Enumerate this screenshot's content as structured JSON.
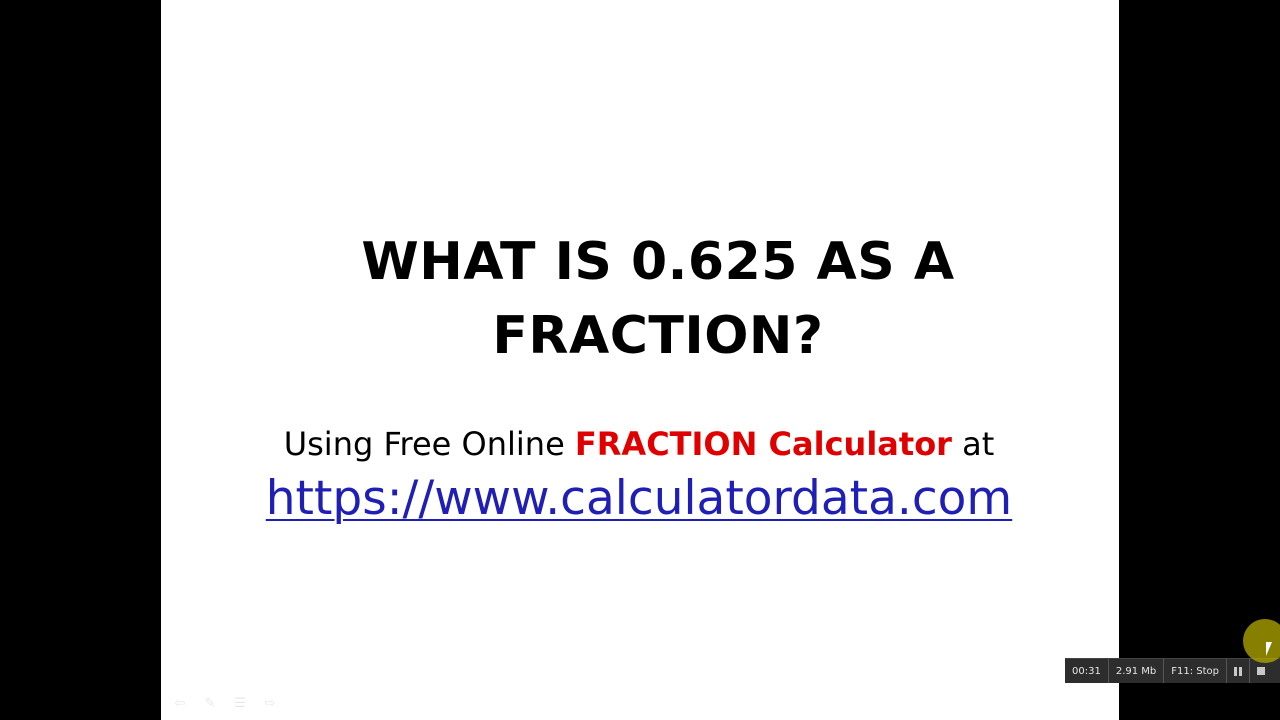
{
  "slide": {
    "title_line1": "WHAT IS 0.625 AS A",
    "title_line2": "FRACTION?",
    "subtitle_before": "Using Free Online ",
    "subtitle_highlight": "FRACTION Calculator",
    "subtitle_after": " at",
    "link": "https://www.calculatordata.com",
    "colors": {
      "background": "#ffffff",
      "highlight": "#e00000",
      "link": "#1f1fb5"
    },
    "controls": {
      "back_icon": "⇦",
      "pen_icon": "✎",
      "menu_icon": "☰",
      "forward_icon": "⇨"
    }
  },
  "recorder": {
    "time": "00:31",
    "size": "2.91 Mb",
    "stop_hint": "F11: Stop"
  }
}
